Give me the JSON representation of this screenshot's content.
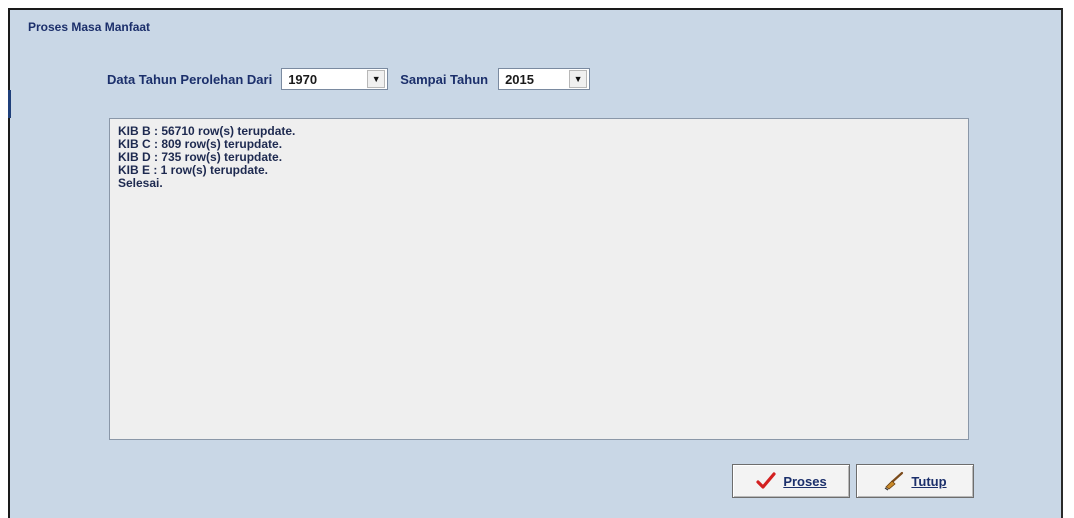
{
  "window": {
    "title": "Proses Masa Manfaat"
  },
  "filter": {
    "from_label": "Data Tahun Perolehan Dari",
    "from_value": "1970",
    "to_label": "Sampai Tahun",
    "to_value": "2015"
  },
  "log": {
    "lines": [
      "KIB B : 56710 row(s) terupdate.",
      "KIB C : 809 row(s) terupdate.",
      "KIB D : 735 row(s) terupdate.",
      "KIB E : 1 row(s) terupdate.",
      "Selesai."
    ]
  },
  "buttons": {
    "proses_label": "Proses",
    "proses_icon": "checkmark-icon",
    "tutup_label": "Tutup",
    "tutup_icon": "broom-icon"
  },
  "colors": {
    "panel_bg": "#c9d7e6",
    "label_text": "#1b2f6b",
    "check_red": "#d32020"
  }
}
